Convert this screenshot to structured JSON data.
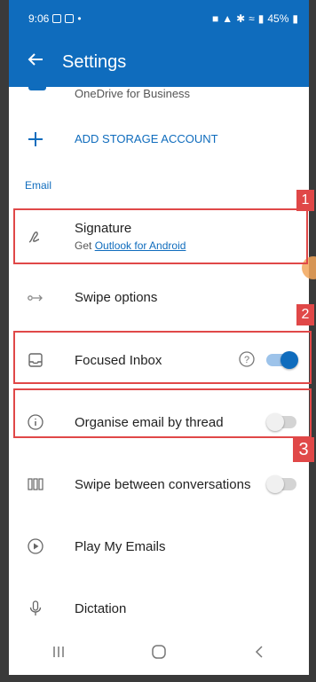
{
  "status_bar": {
    "time": "9:06",
    "battery": "45%"
  },
  "app_bar": {
    "title": "Settings"
  },
  "accounts": {
    "onedrive_label": "OneDrive for Business",
    "add_storage_label": "ADD STORAGE ACCOUNT"
  },
  "email_section": {
    "header": "Email"
  },
  "items": {
    "signature": {
      "label": "Signature",
      "sub_prefix": "Get ",
      "sub_link": "Outlook for Android"
    },
    "swipe_options": {
      "label": "Swipe options"
    },
    "focused_inbox": {
      "label": "Focused Inbox",
      "enabled": true
    },
    "organise_thread": {
      "label": "Organise email by thread",
      "enabled": false
    },
    "swipe_conversations": {
      "label": "Swipe between conversations",
      "enabled": false
    },
    "play_emails": {
      "label": "Play My Emails"
    },
    "dictation": {
      "label": "Dictation"
    }
  },
  "annotations": [
    "1",
    "2",
    "3"
  ],
  "colors": {
    "accent": "#0f6cbd",
    "annotation": "#e04848"
  },
  "icons": {
    "back": "arrow-left-icon",
    "add": "plus-icon",
    "signature": "signature-pen-icon",
    "swipe": "swipe-arrow-icon",
    "focused": "inbox-tray-icon",
    "help": "question-circle-icon",
    "thread": "info-circle-icon",
    "conversations": "columns-icon",
    "play": "play-circle-icon",
    "dictation": "microphone-icon"
  }
}
